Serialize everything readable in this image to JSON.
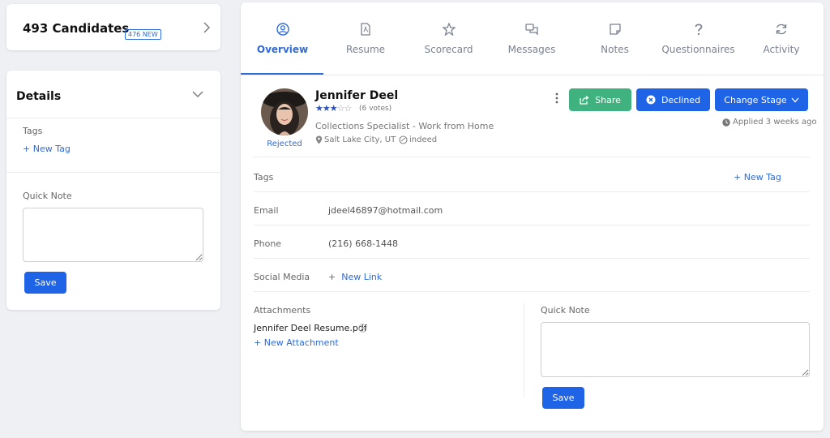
{
  "sidebar": {
    "candidates_title": "493 Candidates",
    "new_badge": "476 NEW",
    "details_title": "Details",
    "tags_label": "Tags",
    "new_tag": "+ New Tag",
    "quick_note_label": "Quick Note",
    "quick_note_value": "",
    "save_label": "Save"
  },
  "tabs": [
    {
      "label": "Overview",
      "icon": "user-circle-icon",
      "active": true
    },
    {
      "label": "Resume",
      "icon": "pdf-file-icon"
    },
    {
      "label": "Scorecard",
      "icon": "star-edit-icon"
    },
    {
      "label": "Messages",
      "icon": "chat-bubbles-icon"
    },
    {
      "label": "Notes",
      "icon": "sticky-note-icon"
    },
    {
      "label": "Questionnaires",
      "icon": "question-mark-icon"
    },
    {
      "label": "Activity",
      "icon": "refresh-icon"
    }
  ],
  "candidate": {
    "name": "Jennifer Deel",
    "status": "Rejected",
    "rating": 3,
    "rating_max": 5,
    "votes": "(6 votes)",
    "job_title": "Collections Specialist - Work from Home",
    "location": "Salt Lake City, UT",
    "source": "indeed",
    "applied": "Applied 3 weeks ago"
  },
  "actions": {
    "share": "Share",
    "declined": "Declined",
    "change_stage": "Change Stage"
  },
  "fields": {
    "tags_label": "Tags",
    "new_tag": "+ New Tag",
    "email_label": "Email",
    "email_value": "jdeel46897@hotmail.com",
    "phone_label": "Phone",
    "phone_value": "(216) 668-1448",
    "social_label": "Social Media",
    "new_link": "+  New Link"
  },
  "attachments": {
    "title": "Attachments",
    "file": "Jennifer Deel Resume.pdf",
    "new_attachment": "+ New Attachment"
  },
  "quick_note": {
    "label": "Quick Note",
    "value": "",
    "save_label": "Save"
  },
  "colors": {
    "accent": "#1f63e6",
    "link": "#2f6bd8",
    "share_green": "#3fb27f",
    "background": "#eef0f3"
  }
}
